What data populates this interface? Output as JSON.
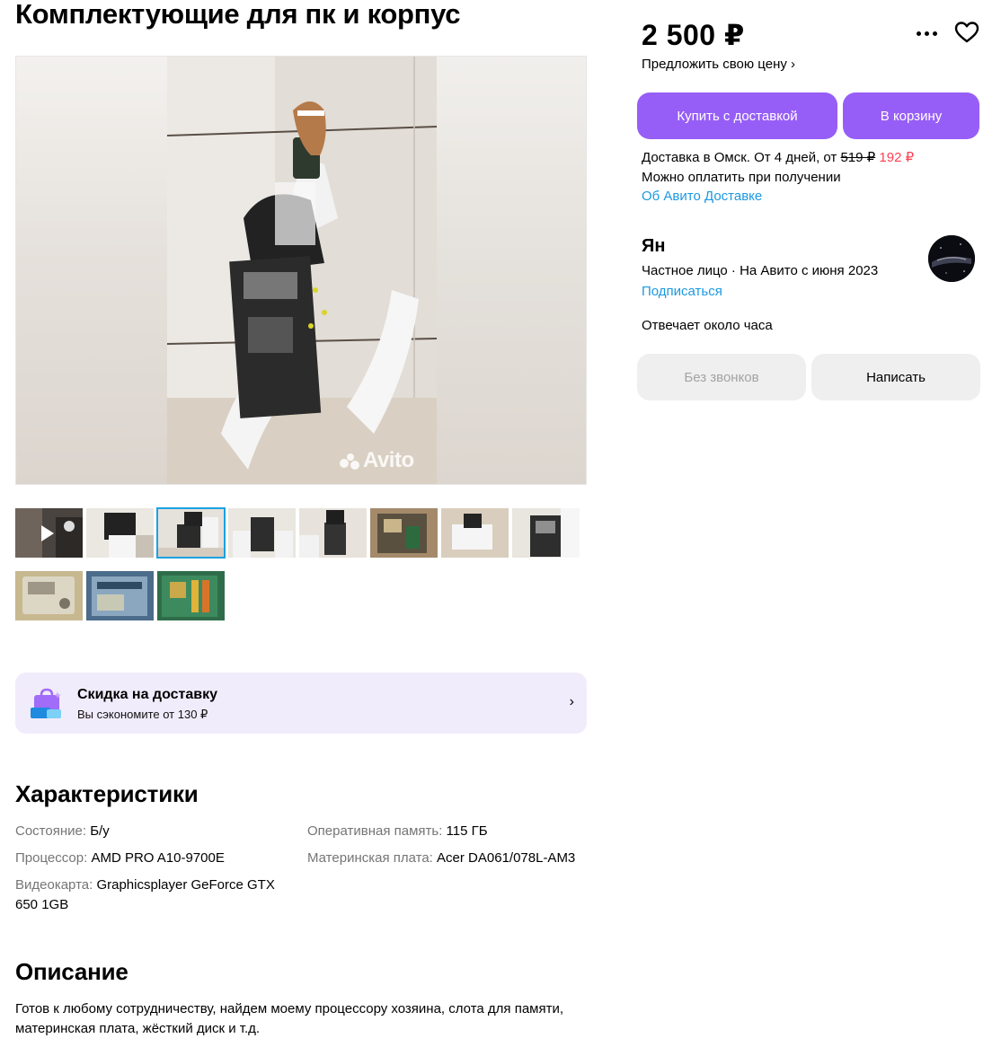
{
  "listing": {
    "title": "Комплектующие для пк и корпус",
    "watermark": "Avito"
  },
  "thumbnails": {
    "active_index": 2,
    "count": 11,
    "video_first": true
  },
  "promo": {
    "title": "Скидка на доставку",
    "subtitle": "Вы сэкономите от 130 ₽",
    "chevron": "›"
  },
  "characteristics": {
    "heading": "Характеристики",
    "items": [
      {
        "key": "Состояние:",
        "value": "Б/у"
      },
      {
        "key": "Процессор:",
        "value": "AMD PRO A10-9700E"
      },
      {
        "key": "Видеокарта:",
        "value": "Graphicsplayer GeForce GTX 650 1GB"
      },
      {
        "key": "Оперативная память:",
        "value": "115 ГБ"
      },
      {
        "key": "Материнская плата:",
        "value": "Acer DA061/078L-AM3"
      }
    ]
  },
  "description": {
    "heading": "Описание",
    "text": "Готов к любому сотрудничеству, найдем моему процессору хозяина, слота для памяти, материнская плата, жёсткий диск и т.д."
  },
  "price": {
    "value": "2 500 ₽",
    "offer_link": "Предложить свою цену ›"
  },
  "actions": {
    "buy_delivery": "Купить с доставкой",
    "cart": "В корзину",
    "no_calls": "Без звонков",
    "write": "Написать"
  },
  "delivery": {
    "text_prefix": "Доставка в Омск. От 4 дней, от ",
    "old_price": "519 ₽",
    "new_price": "192 ₽",
    "payment": "Можно оплатить при получении",
    "about_link": "Об Авито Доставке"
  },
  "seller": {
    "name": "Ян",
    "info": "Частное лицо · На Авито с июня 2023",
    "subscribe": "Подписаться",
    "response": "Отвечает около часа"
  },
  "colors": {
    "accent": "#975ef7",
    "link": "#1b99e0",
    "price_new": "#ff4053",
    "promo_bg": "#f1ecfb"
  },
  "icons": [
    "more-icon",
    "heart-icon",
    "play-icon",
    "delivery-discount-icon",
    "chevron-right-icon"
  ]
}
